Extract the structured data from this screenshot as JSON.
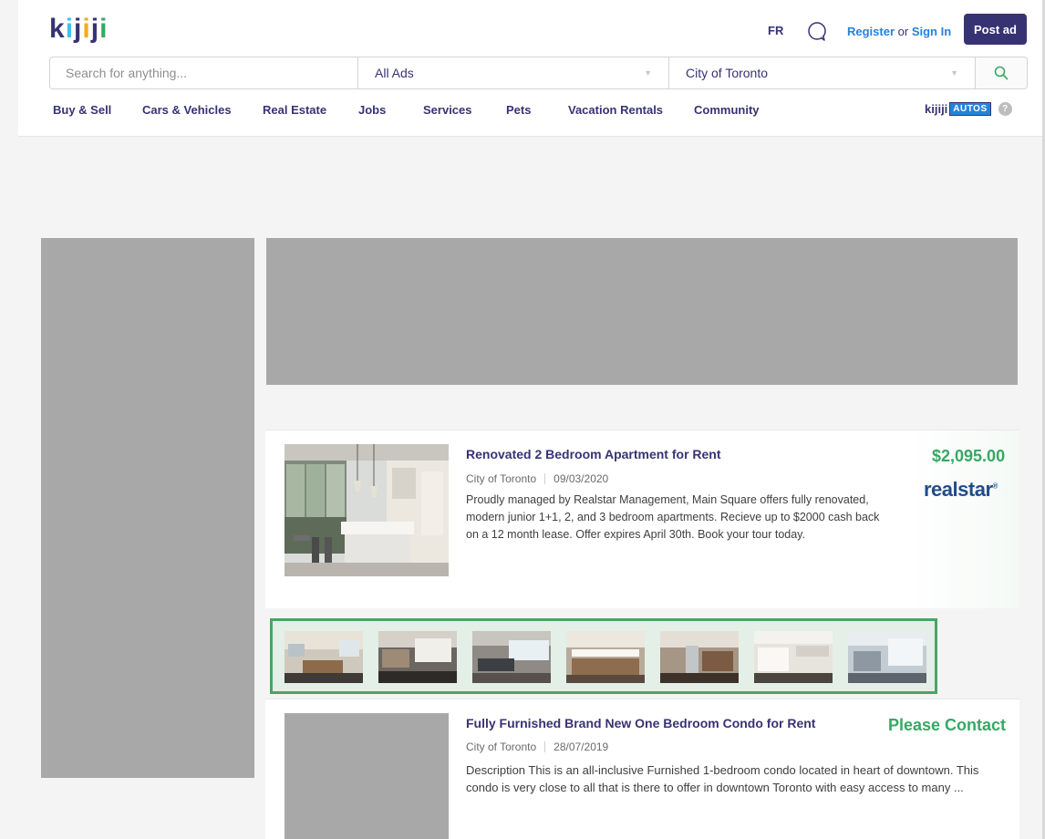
{
  "header": {
    "logo": [
      "k",
      "i",
      "j",
      "i",
      "j",
      "i"
    ],
    "lang": "FR",
    "register": "Register",
    "or": " or ",
    "signin": "Sign In",
    "post_ad": "Post ad",
    "chat_icon": "chat-bubble-icon"
  },
  "search": {
    "placeholder": "Search for anything...",
    "category": "All Ads",
    "location": "City of Toronto",
    "search_icon": "magnifier-icon"
  },
  "nav": [
    "Buy & Sell",
    "Cars & Vehicles",
    "Real Estate",
    "Jobs",
    "Services",
    "Pets",
    "Vacation Rentals",
    "Community"
  ],
  "autos": {
    "brand": "kijiji",
    "tag": "AUTOS",
    "help": "?"
  },
  "listings": [
    {
      "title": "Renovated 2 Bedroom Apartment for Rent",
      "location": "City of Toronto",
      "date": "09/03/2020",
      "description": "Proudly managed by Realstar Management, Main Square offers fully renovated, modern junior 1+1, 2, and 3 bedroom apartments. Recieve up to $2000 cash back on a 12 month lease. Offer expires April 30th. Book your tour today.",
      "price": "$2,095.00",
      "advertiser": "realstar"
    },
    {
      "title": "Fully Furnished Brand New One Bedroom Condo for Rent",
      "location": "City of Toronto",
      "date": "28/07/2019",
      "description": "Description This is an all-inclusive Furnished 1-bedroom condo located in heart of downtown. This condo is very close to all that is there to offer in downtown Toronto with easy access to many ...",
      "price": "Please Contact"
    }
  ],
  "colors": {
    "brand": "#373373",
    "link": "#2681db",
    "price": "#37a864",
    "ad_placeholder": "#a8a8a8",
    "strip_border": "#4ea364"
  }
}
